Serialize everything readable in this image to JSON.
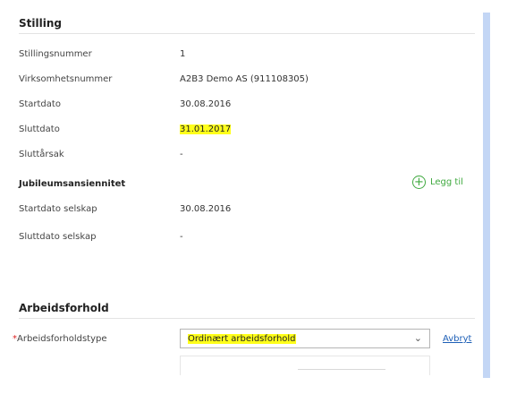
{
  "stilling": {
    "title": "Stilling",
    "rows": [
      {
        "label": "Stillingsnummer",
        "value": "1"
      },
      {
        "label": "Virksomhetsnummer",
        "value": "A2B3 Demo AS (911108305)"
      },
      {
        "label": "Startdato",
        "value": "30.08.2016"
      },
      {
        "label": "Sluttdato",
        "value": "31.01.2017"
      },
      {
        "label": "Sluttårsak",
        "value": "-"
      }
    ]
  },
  "jubileum": {
    "title": "Jubileumsansiennitet",
    "add_label": "Legg til",
    "rows": [
      {
        "label": "Startdato selskap",
        "value": "30.08.2016"
      },
      {
        "label": "Sluttdato selskap",
        "value": "-"
      }
    ]
  },
  "arbeidsforhold": {
    "title": "Arbeidsforhold",
    "required_marker": "*",
    "type_label": "Arbeidsforholdstype",
    "type_value": "Ordinært arbeidsforhold",
    "cancel_label": "Avbryt"
  },
  "colors": {
    "highlight": "#ffff1a",
    "add_green": "#3fa93f",
    "link_blue": "#1d5fb6",
    "scrollbar": "#c3d6f5"
  },
  "icons": {
    "add": "plus-circle-icon",
    "dropdown": "chevron-down-icon"
  }
}
